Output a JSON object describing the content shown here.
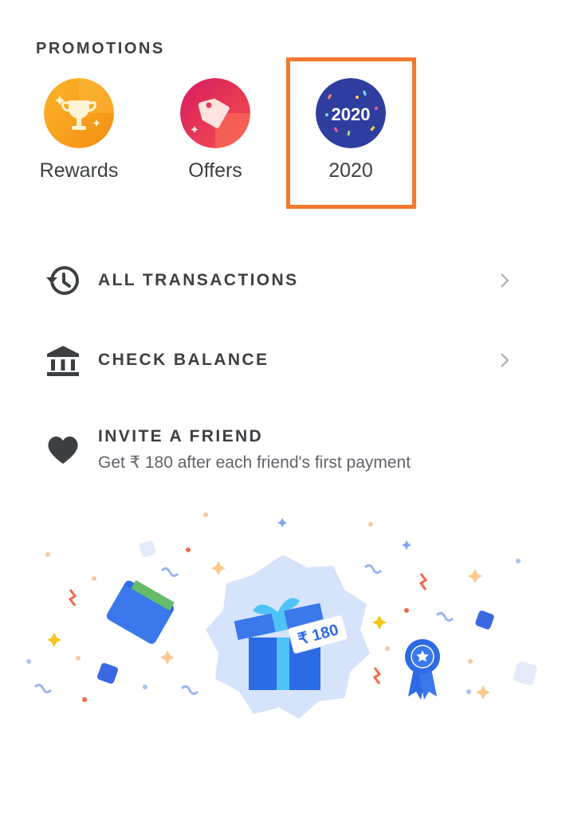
{
  "promotions": {
    "section_title": "PROMOTIONS",
    "items": [
      {
        "label": "Rewards",
        "icon": "trophy-icon",
        "color": "#f9a21b"
      },
      {
        "label": "Offers",
        "icon": "tag-icon",
        "color": "#e8344e"
      },
      {
        "label": "2020",
        "icon": "2020-badge-icon",
        "badge_text": "2020",
        "color": "#2f3e9e"
      }
    ],
    "highlight_color": "#f5782c"
  },
  "menu": {
    "all_transactions": {
      "label": "ALL TRANSACTIONS",
      "icon": "history-icon"
    },
    "check_balance": {
      "label": "CHECK BALANCE",
      "icon": "bank-icon"
    },
    "invite_friend": {
      "label": "INVITE A FRIEND",
      "subtitle": "Get ₹ 180 after each friend's first payment",
      "icon": "heart-icon"
    }
  },
  "banner": {
    "tag_text": "₹ 180",
    "gift_color": "#2d6be4",
    "ribbon_color": "#4fc3f7",
    "badge_color": "#d6e4fb"
  }
}
